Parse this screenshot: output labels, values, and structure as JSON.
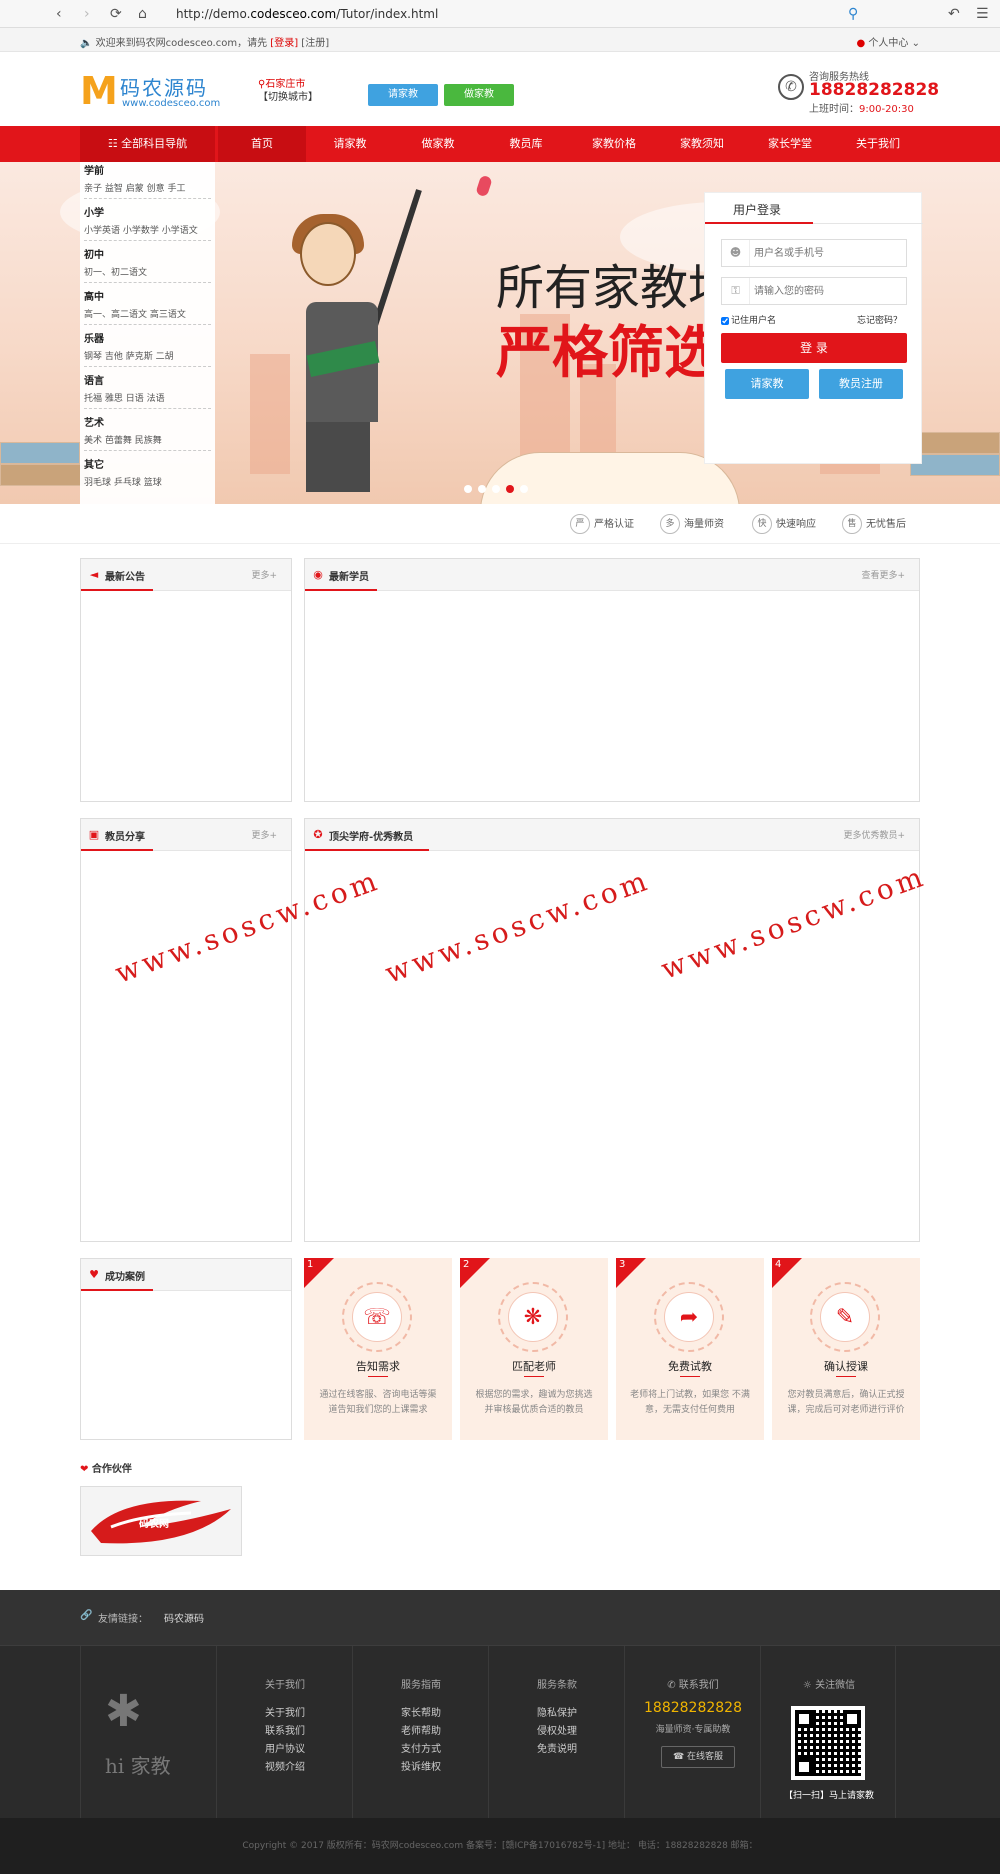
{
  "browser": {
    "url_prefix": "http://demo.",
    "url_host": "codesceo.com",
    "url_path": "/Tutor/index.html"
  },
  "topbar": {
    "welcome": "欢迎来到码农网codesceo.com，请先",
    "login_link": "[登录]",
    "register_link": "[注册]",
    "user_center": "个人中心"
  },
  "header": {
    "logo_cn": "码农源码",
    "logo_en": "www.codesceo.com",
    "city": "石家庄市",
    "city_switch": "【切换城市】",
    "btn_request": "请家教",
    "btn_become": "做家教",
    "hotline_label": "咨询服务热线",
    "hotline_number": "18828282828",
    "hours_label": "上班时间：",
    "hours_value": "9:00-20:30"
  },
  "nav": {
    "all_subjects": "全部科目导航",
    "items": [
      "首页",
      "请家教",
      "做家教",
      "教员库",
      "家教价格",
      "家教须知",
      "家长学堂",
      "关于我们"
    ]
  },
  "categories": [
    {
      "title": "学前",
      "subs": "亲子  益智  启蒙  创意  手工"
    },
    {
      "title": "小学",
      "subs": "小学英语  小学数学  小学语文"
    },
    {
      "title": "初中",
      "subs": "初一、初二语文"
    },
    {
      "title": "高中",
      "subs": "高一、高二语文  高三语文"
    },
    {
      "title": "乐器",
      "subs": "钢琴  吉他  萨克斯  二胡"
    },
    {
      "title": "语言",
      "subs": "托福  雅思  日语  法语"
    },
    {
      "title": "艺术",
      "subs": "美术  芭蕾舞  民族舞"
    },
    {
      "title": "其它",
      "subs": "羽毛球  乒乓球  篮球"
    }
  ],
  "banner": {
    "line1": "所有家教均",
    "line2": "严格筛选",
    "active_slide": 4,
    "slides": 5
  },
  "login": {
    "title": "用户登录",
    "username_placeholder": "用户名或手机号",
    "password_placeholder": "请输入您的密码",
    "remember": "记住用户名",
    "forgot": "忘记密码？",
    "submit": "登 录",
    "btn_request": "请家教",
    "btn_register": "教员注册"
  },
  "features": [
    {
      "badge": "严",
      "label": "严格认证"
    },
    {
      "badge": "多",
      "label": "海量师资"
    },
    {
      "badge": "快",
      "label": "快速响应"
    },
    {
      "badge": "售",
      "label": "无忧售后"
    }
  ],
  "panels": {
    "notice": {
      "title": "最新公告",
      "more": "更多+"
    },
    "students": {
      "title": "最新学员",
      "more": "查看更多+"
    },
    "share": {
      "title": "教员分享",
      "more": "更多+"
    },
    "top_teachers": {
      "title": "顶尖学府-优秀教员",
      "more": "更多优秀教员+"
    },
    "cases": {
      "title": "成功案例"
    }
  },
  "watermark": "www.soscw.com",
  "steps": [
    {
      "n": "1",
      "icon": "headset-icon",
      "title": "告知需求",
      "desc": "通过在线客服、咨询电话等渠道告知我们您的上课需求"
    },
    {
      "n": "2",
      "icon": "network-icon",
      "title": "匹配老师",
      "desc": "根据您的需求，趣诚为您挑选并审核最优质合适的教员"
    },
    {
      "n": "3",
      "icon": "door-icon",
      "title": "免费试教",
      "desc": "老师将上门试教，如果您 不满意，无需支付任何费用"
    },
    {
      "n": "4",
      "icon": "document-icon",
      "title": "确认授课",
      "desc": "您对教员满意后，确认正式授课，完成后可对老师进行评价"
    }
  ],
  "partners": {
    "title": "合作伙伴",
    "logo_text": "码农网"
  },
  "footer": {
    "friend_links_label": "友情链接：",
    "friend_link": "码农源码",
    "brand": "hi 家教",
    "cols": [
      {
        "title": "关于我们",
        "links": [
          "关于我们",
          "联系我们",
          "用户协议",
          "视频介绍"
        ]
      },
      {
        "title": "服务指南",
        "links": [
          "家长帮助",
          "老师帮助",
          "支付方式",
          "投诉维权"
        ]
      },
      {
        "title": "服务条款",
        "links": [
          "隐私保护",
          "侵权处理",
          "免责说明"
        ]
      }
    ],
    "contact_title": "联系我们",
    "contact_phone": "18828282828",
    "contact_sub": "海量师资·专属助教",
    "online_service": "在线客服",
    "wechat_title": "关注微信",
    "wechat_caption": "【扫一扫】马上请家教",
    "copyright": "Copyright © 2017 版权所有：码农网codesceo.com    备案号：[赣ICP备17016782号-1]    地址：    电话：18828282828    邮箱："
  },
  "colors": {
    "brand_red": "#e1151a",
    "brand_blue": "#3fa2e0",
    "brand_green": "#4ab83e"
  }
}
